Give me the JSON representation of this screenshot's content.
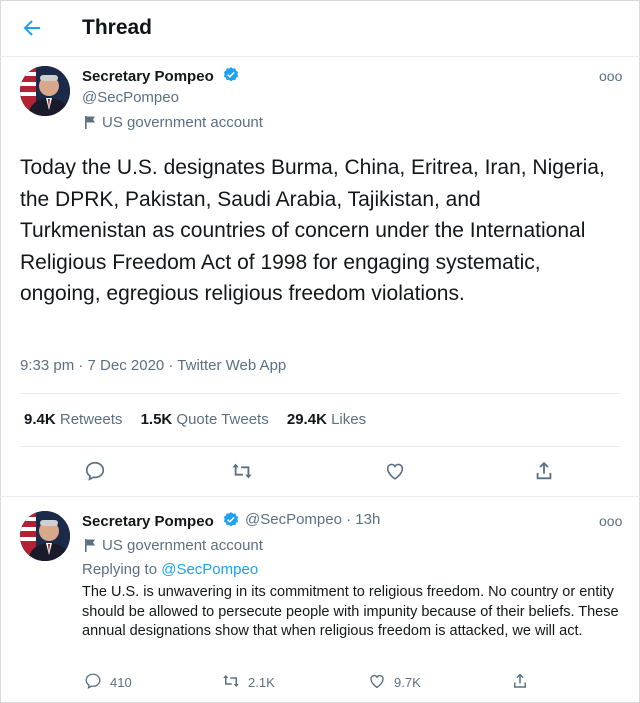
{
  "header": {
    "title": "Thread",
    "back_icon": "arrow-left-icon"
  },
  "main_tweet": {
    "name": "Secretary Pompeo",
    "handle": "@SecPompeo",
    "label": "US government account",
    "text": "Today the U.S. designates Burma, China, Eritrea, Iran, Nigeria, the DPRK, Pakistan, Saudi Arabia, Tajikistan, and Turkmenistan as countries of concern under the International Religious Freedom Act of 1998 for engaging systematic, ongoing, egregious religious freedom violations.",
    "meta": "9:33 pm · 7 Dec 2020 · Twitter Web App",
    "stats": {
      "retweets_count": "9.4K",
      "retweets_label": "Retweets",
      "quotes_count": "1.5K",
      "quotes_label": "Quote Tweets",
      "likes_count": "29.4K",
      "likes_label": "Likes"
    },
    "more": "ooo"
  },
  "reply_tweet": {
    "name": "Secretary Pompeo",
    "handle_time": "@SecPompeo · 13h",
    "label": "US government account",
    "replying_prefix": "Replying to",
    "replying_handle": "@SecPompeo",
    "text": "The U.S. is unwavering in its commitment to religious freedom. No country or entity should be allowed to persecute people with impunity because of their beliefs. These annual designations show that when religious freedom is attacked, we will act.",
    "replies": "410",
    "retweets": "2.1K",
    "likes": "9.7K",
    "more": "ooo"
  },
  "colors": {
    "accent": "#1da1f2",
    "muted": "#5b7083",
    "text": "#14171a",
    "divider": "#e6ecf0"
  }
}
